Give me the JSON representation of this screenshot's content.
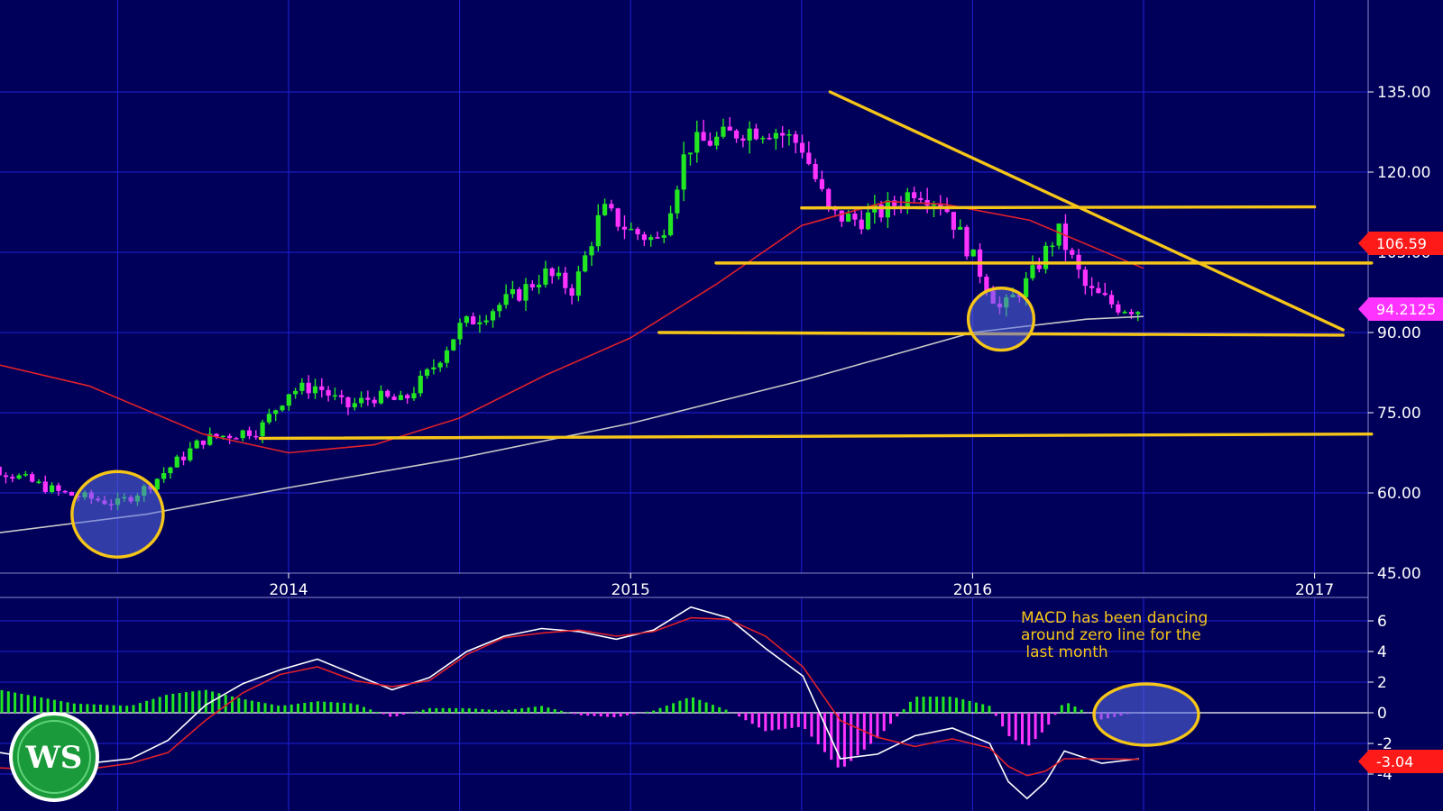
{
  "colors": {
    "background": "#00005a",
    "grid": "#1f1fd6",
    "up_candle": "#22e622",
    "down_candle": "#ff33ff",
    "ma_red": "#e0202a",
    "ma_white": "#c8c8c8",
    "annotation": "#f5c518",
    "hist_pos": "#22e622",
    "hist_neg": "#ff33ff",
    "macd_line": "#ffffff",
    "signal_line": "#e0202a",
    "tag_red": "#ff1a1a",
    "tag_magenta": "#ff33ff"
  },
  "chart_data": [
    {
      "type": "candlestick",
      "x_ticks": [
        "2014",
        "2015",
        "2016",
        "2017"
      ],
      "y_ticks": [
        "45.00",
        "60.00",
        "75.00",
        "90.00",
        "105.00",
        "120.00",
        "135.00"
      ],
      "ylim": [
        45,
        150
      ],
      "xlim": [
        "2013-02",
        "2017-03"
      ],
      "grid": true,
      "price_path": [
        [
          "2013-02",
          66
        ],
        [
          "2013-05",
          60
        ],
        [
          "2013-07",
          58
        ],
        [
          "2013-08",
          61
        ],
        [
          "2013-10",
          70
        ],
        [
          "2013-12",
          72
        ],
        [
          "2014-01",
          79
        ],
        [
          "2014-02",
          80
        ],
        [
          "2014-03",
          76
        ],
        [
          "2014-04",
          78
        ],
        [
          "2014-05",
          77
        ],
        [
          "2014-06",
          83
        ],
        [
          "2014-07",
          91
        ],
        [
          "2014-08",
          94
        ],
        [
          "2014-09",
          97
        ],
        [
          "2014-10",
          101
        ],
        [
          "2014-11",
          98
        ],
        [
          "2014-12",
          113
        ],
        [
          "2015-01",
          109
        ],
        [
          "2015-02",
          107
        ],
        [
          "2015-03",
          125
        ],
        [
          "2015-04",
          126
        ],
        [
          "2015-05",
          128
        ],
        [
          "2015-06",
          128
        ],
        [
          "2015-07",
          125
        ],
        [
          "2015-08",
          112
        ],
        [
          "2015-09",
          111
        ],
        [
          "2015-10",
          113
        ],
        [
          "2015-11",
          117
        ],
        [
          "2015-12",
          114
        ],
        [
          "2016-01",
          104
        ],
        [
          "2016-02",
          94
        ],
        [
          "2016-03",
          100
        ],
        [
          "2016-04",
          109
        ],
        [
          "2016-05",
          98
        ],
        [
          "2016-06",
          95
        ],
        [
          "2016-07",
          94.2
        ]
      ],
      "moving_average_red": [
        [
          "2013-02",
          85
        ],
        [
          "2013-06",
          80
        ],
        [
          "2013-10",
          71
        ],
        [
          "2014-01",
          67.5
        ],
        [
          "2014-04",
          69
        ],
        [
          "2014-07",
          74
        ],
        [
          "2014-10",
          82
        ],
        [
          "2015-01",
          89
        ],
        [
          "2015-04",
          99
        ],
        [
          "2015-07",
          110
        ],
        [
          "2015-10",
          114.5
        ],
        [
          "2015-12",
          114
        ],
        [
          "2016-03",
          111
        ],
        [
          "2016-07",
          102
        ]
      ],
      "moving_average_white": [
        [
          "2013-02",
          52
        ],
        [
          "2013-08",
          56
        ],
        [
          "2014-01",
          61
        ],
        [
          "2014-07",
          66.5
        ],
        [
          "2015-01",
          73
        ],
        [
          "2015-07",
          81
        ],
        [
          "2016-01",
          90
        ],
        [
          "2016-05",
          92.5
        ],
        [
          "2016-07",
          93
        ]
      ],
      "trendlines": [
        {
          "from": [
            "2015-08",
            135
          ],
          "to": [
            "2017-02",
            90.5
          ]
        },
        {
          "from": [
            "2015-07",
            113.3
          ],
          "to": [
            "2017-01",
            113.5
          ]
        },
        {
          "from": [
            "2015-04",
            103
          ],
          "to": [
            "2017-03",
            103
          ]
        },
        {
          "from": [
            "2015-02",
            90
          ],
          "to": [
            "2017-02",
            89.5
          ]
        },
        {
          "from": [
            "2013-12",
            70.2
          ],
          "to": [
            "2017-03",
            71
          ]
        }
      ],
      "circles": [
        {
          "center": [
            "2013-07",
            56
          ],
          "rx_months": 1.6,
          "ry_value": 8
        },
        {
          "center": [
            "2016-02",
            92.5
          ],
          "rx_months": 1.15,
          "ry_value": 5.8
        }
      ],
      "last_red_ma_label": "106.59",
      "last_price_label": "94.2125"
    },
    {
      "type": "macd",
      "y_ticks": [
        "6",
        "4",
        "2",
        "0",
        "-2",
        "-4"
      ],
      "ylim": [
        -6.2,
        7.2
      ],
      "macd_line": [
        [
          "2013-02",
          -2.6
        ],
        [
          "2013-06",
          -3.4
        ],
        [
          "2013-09",
          -3
        ],
        [
          "2013-11",
          -1.8
        ],
        [
          "2014-01",
          0.5
        ],
        [
          "2014-03",
          1.9
        ],
        [
          "2014-05",
          2.8
        ],
        [
          "2014-07",
          3.5
        ],
        [
          "2014-09",
          2.5
        ],
        [
          "2014-11",
          1.5
        ],
        [
          "2015-01",
          2.3
        ],
        [
          "2015-03",
          4
        ],
        [
          "2015-05",
          5
        ],
        [
          "2015-07",
          5.5
        ],
        [
          "2015-09",
          5.3
        ],
        [
          "2015-11",
          4.8
        ],
        [
          "2016-01",
          5.4
        ],
        [
          "2016-03",
          6.9
        ],
        [
          "2016-05",
          6.2
        ],
        [
          "2016-07",
          4.2
        ],
        [
          "2016-09",
          2.4
        ],
        [
          "2016-11",
          -3
        ],
        [
          "2017-01",
          -2.7
        ],
        [
          "2017-03",
          -1.5
        ],
        [
          "2017-05",
          -1
        ],
        [
          "2017-07",
          -2
        ],
        [
          "2017-08",
          -4.5
        ],
        [
          "2017-09",
          -5.6
        ],
        [
          "2017-10",
          -4.5
        ],
        [
          "2017-11",
          -2.5
        ],
        [
          "2018-01",
          -3.3
        ],
        [
          "2018-03",
          -3
        ]
      ],
      "signal_line": [
        [
          "2013-02",
          -3.6
        ],
        [
          "2013-06",
          -3.8
        ],
        [
          "2013-09",
          -3.3
        ],
        [
          "2013-11",
          -2.6
        ],
        [
          "2014-01",
          -0.5
        ],
        [
          "2014-03",
          1.3
        ],
        [
          "2014-05",
          2.5
        ],
        [
          "2014-07",
          3
        ],
        [
          "2014-09",
          2.1
        ],
        [
          "2014-11",
          1.7
        ],
        [
          "2015-01",
          2.1
        ],
        [
          "2015-03",
          3.8
        ],
        [
          "2015-05",
          4.9
        ],
        [
          "2015-07",
          5.2
        ],
        [
          "2015-09",
          5.4
        ],
        [
          "2015-11",
          5
        ],
        [
          "2016-01",
          5.3
        ],
        [
          "2016-03",
          6.2
        ],
        [
          "2016-05",
          6.1
        ],
        [
          "2016-07",
          5
        ],
        [
          "2016-09",
          3
        ],
        [
          "2016-11",
          -0.5
        ],
        [
          "2017-01",
          -1.6
        ],
        [
          "2017-03",
          -2.2
        ],
        [
          "2017-05",
          -1.7
        ],
        [
          "2017-07",
          -2.3
        ],
        [
          "2017-08",
          -3.5
        ],
        [
          "2017-09",
          -4.1
        ],
        [
          "2017-10",
          -3.8
        ],
        [
          "2017-11",
          -3
        ],
        [
          "2018-01",
          -3
        ],
        [
          "2018-03",
          -3.04
        ]
      ],
      "last_value_label": "-3.04",
      "note": [
        "MACD has been dancing",
        "around zero line for the",
        " last month"
      ]
    }
  ],
  "logo": "WS"
}
